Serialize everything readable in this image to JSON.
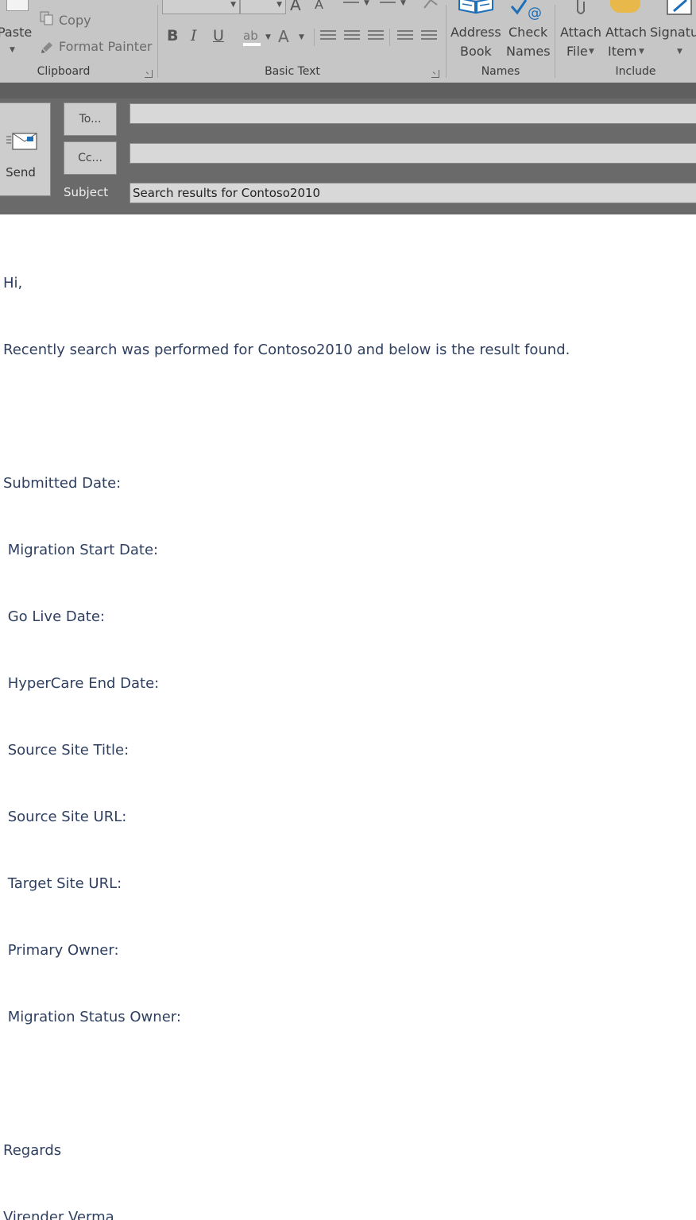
{
  "ribbon": {
    "clipboard": {
      "paste_label": "Paste",
      "copy_label": "Copy",
      "format_painter_label": "Format Painter",
      "group_label": "Clipboard"
    },
    "basic_text": {
      "bold": "B",
      "italic": "I",
      "underline": "U",
      "grow_font": "A",
      "shrink_font": "A",
      "font_color": "A",
      "group_label": "Basic Text"
    },
    "names": {
      "address_book_label_1": "Address",
      "address_book_label_2": "Book",
      "check_names_label_1": "Check",
      "check_names_label_2": "Names",
      "group_label": "Names"
    },
    "include": {
      "attach_file_label_1": "Attach",
      "attach_file_label_2": "File",
      "attach_item_label_1": "Attach",
      "attach_item_label_2": "Item",
      "signature_label": "Signatu",
      "group_label": "Include"
    }
  },
  "header": {
    "send_label": "Send",
    "to_label": "To...",
    "cc_label": "Cc...",
    "subject_label": "Subject",
    "to_value": "",
    "cc_value": "",
    "subject_value": "Search results for Contoso2010"
  },
  "body": {
    "lines": [
      "Hi,",
      "Recently search was performed for Contoso2010 and below is the result found.",
      "",
      "Submitted Date:",
      " Migration Start Date:",
      " Go Live Date:",
      " HyperCare End Date:",
      " Source Site Title:",
      " Source Site URL:",
      " Target Site URL:",
      " Primary Owner:",
      " Migration Status Owner:",
      "",
      "Regards",
      "Virender Verma"
    ]
  },
  "colors": {
    "ribbon_bg": "#c6c6c6",
    "header_bg": "#6a6a6a",
    "body_text": "#2f3f5f",
    "check_names_accent": "#1e6fb8",
    "attach_item_accent": "#e8b84a"
  }
}
